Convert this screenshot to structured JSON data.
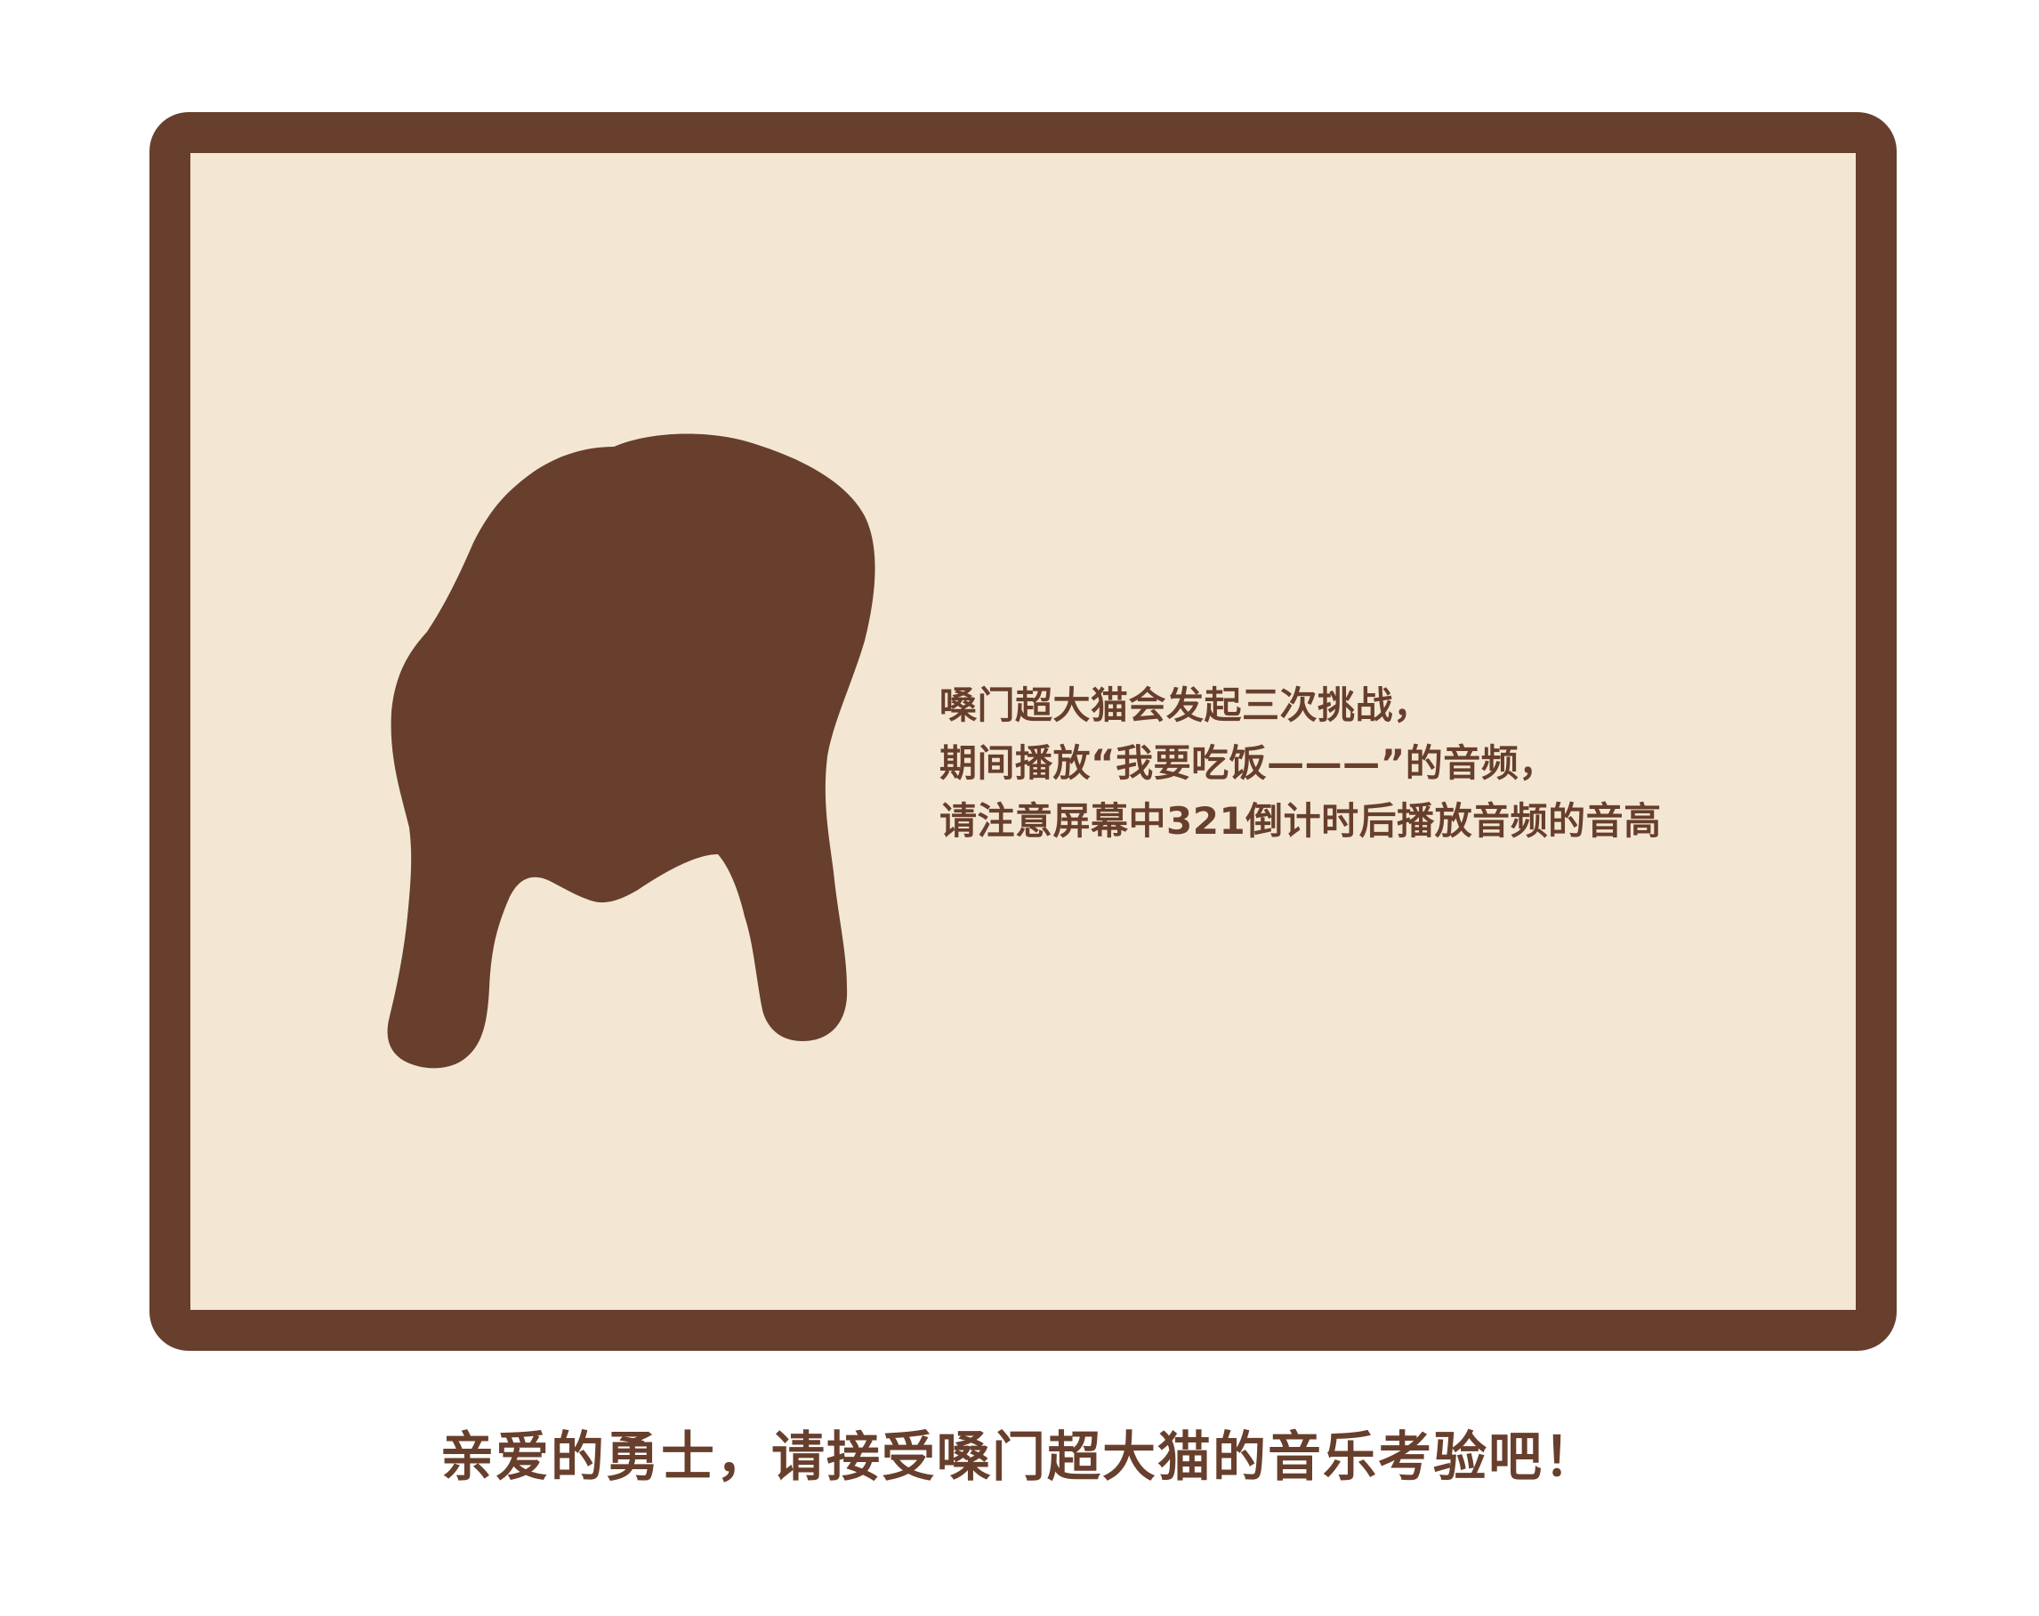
{
  "panel": {
    "instructions": [
      "嗓门超大猫会发起三次挑战，",
      "期间播放“我要吃饭———”的音频，",
      "请注意屏幕中321倒计时后播放音频的音高"
    ]
  },
  "caption": "亲爱的勇士，请接受嗓门超大猫的音乐考验吧！",
  "colors": {
    "brown": "#673f2c",
    "cream": "#f3e7d4",
    "background": "#ffffff"
  },
  "icons": {
    "character": "cat-silhouette-icon"
  }
}
